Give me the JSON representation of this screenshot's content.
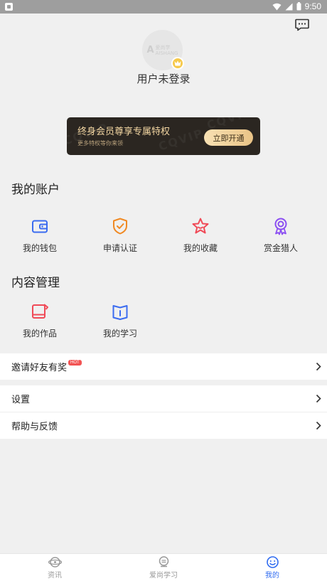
{
  "status_bar": {
    "time": "9:50"
  },
  "profile": {
    "username": "用户未登录"
  },
  "vip_banner": {
    "title": "终身会员尊享专属特权",
    "subtitle": "更多特权等你来领",
    "button_label": "立即开通",
    "watermark": "CQVIP"
  },
  "account": {
    "title": "我的账户",
    "items": [
      {
        "label": "我的钱包",
        "icon": "wallet-icon"
      },
      {
        "label": "申请认证",
        "icon": "shield-check-icon"
      },
      {
        "label": "我的收藏",
        "icon": "star-icon"
      },
      {
        "label": "赏金猎人",
        "icon": "medal-icon"
      }
    ]
  },
  "content": {
    "title": "内容管理",
    "items": [
      {
        "label": "我的作品",
        "icon": "works-icon"
      },
      {
        "label": "我的学习",
        "icon": "book-icon"
      }
    ]
  },
  "menu": {
    "invite": {
      "label": "邀请好友有奖",
      "badge": "HOT"
    },
    "settings": {
      "label": "设置"
    },
    "help": {
      "label": "帮助与反馈"
    }
  },
  "tabs": [
    {
      "label": "资讯",
      "icon": "news-icon",
      "active": false
    },
    {
      "label": "爱尚学习",
      "icon": "learn-icon",
      "active": false
    },
    {
      "label": "我的",
      "icon": "profile-icon",
      "active": true
    }
  ],
  "colors": {
    "accent": "#2f6bf0",
    "wallet": "#3b6cf0",
    "certify": "#f08a24",
    "favorite": "#f04a57",
    "hunter": "#8b4ef2",
    "works": "#f04a57",
    "study": "#3b6cf0",
    "vip_gold": "#f3d6a2"
  }
}
